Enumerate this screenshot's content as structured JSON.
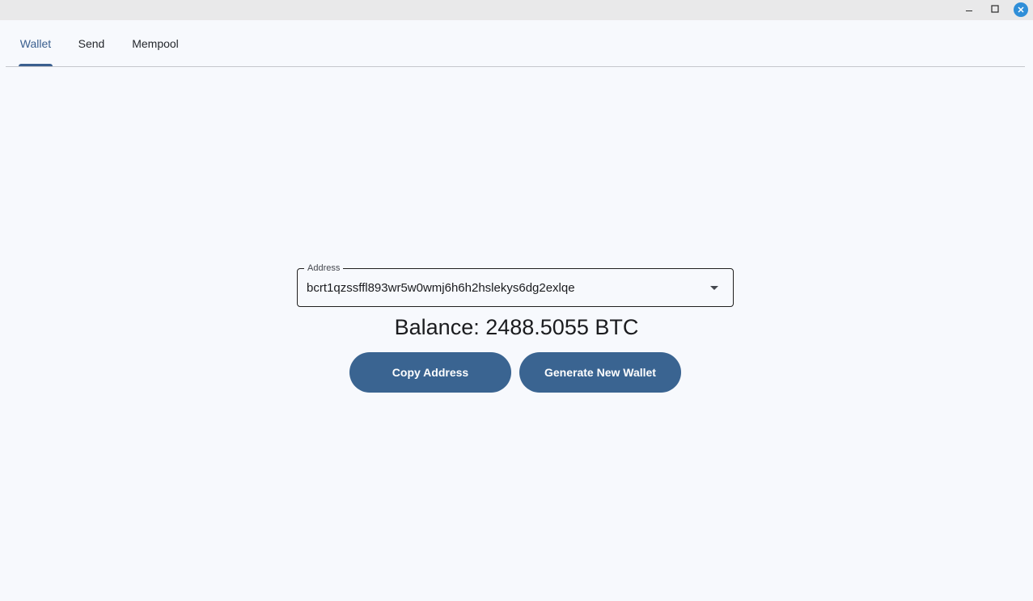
{
  "window": {
    "minimize_icon": "minimize-icon",
    "maximize_icon": "maximize-icon",
    "close_icon": "close-icon",
    "close_color": "#2f8ed8"
  },
  "tabs": [
    {
      "label": "Wallet",
      "active": true
    },
    {
      "label": "Send",
      "active": false
    },
    {
      "label": "Mempool",
      "active": false
    }
  ],
  "address_field": {
    "label": "Address",
    "value": "bcrt1qzssffl893wr5w0wmj6h6h2hslekys6dg2exlqe",
    "icon": "dropdown-arrow-icon"
  },
  "balance_text": "Balance: 2488.5055 BTC",
  "buttons": {
    "copy_label": "Copy Address",
    "generate_label": "Generate New Wallet"
  },
  "colors": {
    "accent": "#3a5f8f",
    "button_bg": "#3a6491",
    "background": "#f7f9fd"
  }
}
